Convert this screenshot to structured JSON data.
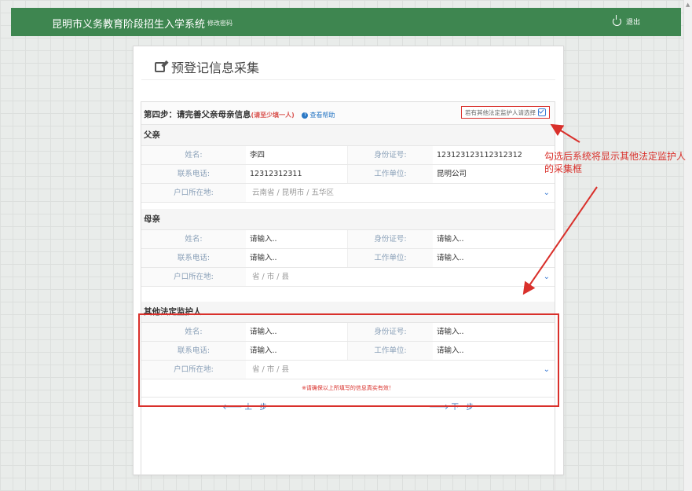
{
  "nav": {
    "title": "昆明市义务教育阶段招生入学系统",
    "change_password": "修改密码",
    "logout": "退出"
  },
  "page": {
    "title": "预登记信息采集",
    "step": "第四步：请完善父亲母亲信息",
    "step_note": "(请至少填一人)",
    "help": "查看帮助",
    "other_guardian_toggle": "若有其他法定监护人请选择",
    "footer_hint": "※请确保以上所填写的信息真实有效！",
    "prev": "上一步",
    "next": "下一步"
  },
  "labels": {
    "name": "姓名:",
    "id": "身份证号:",
    "phone": "联系电话:",
    "work": "工作单位:",
    "address": "户口所在地:"
  },
  "father": {
    "heading": "父亲",
    "name": "李四",
    "id": "123123123112312312",
    "phone": "12312312311",
    "work": "昆明公司",
    "address": "云南省 / 昆明市 / 五华区"
  },
  "mother": {
    "heading": "母亲",
    "name": "请输入..",
    "id": "请输入..",
    "phone": "请输入..",
    "work": "请输入..",
    "address": "省 / 市 / 县"
  },
  "other": {
    "heading": "其他法定监护人",
    "name": "请输入..",
    "id": "请输入..",
    "phone": "请输入..",
    "work": "请输入..",
    "address": "省 / 市 / 县"
  },
  "annotation": "勾选后系统将显示其他法定监护人的采集框",
  "colors": {
    "nav": "#3e8650",
    "annotation": "#d9302b",
    "link": "#3a6fb5"
  },
  "icons": {
    "logout": "power-icon",
    "title": "edit-icon",
    "help": "question-circle-icon",
    "toggle": "checkbox-icon",
    "dropdown": "chevron-down-icon"
  }
}
